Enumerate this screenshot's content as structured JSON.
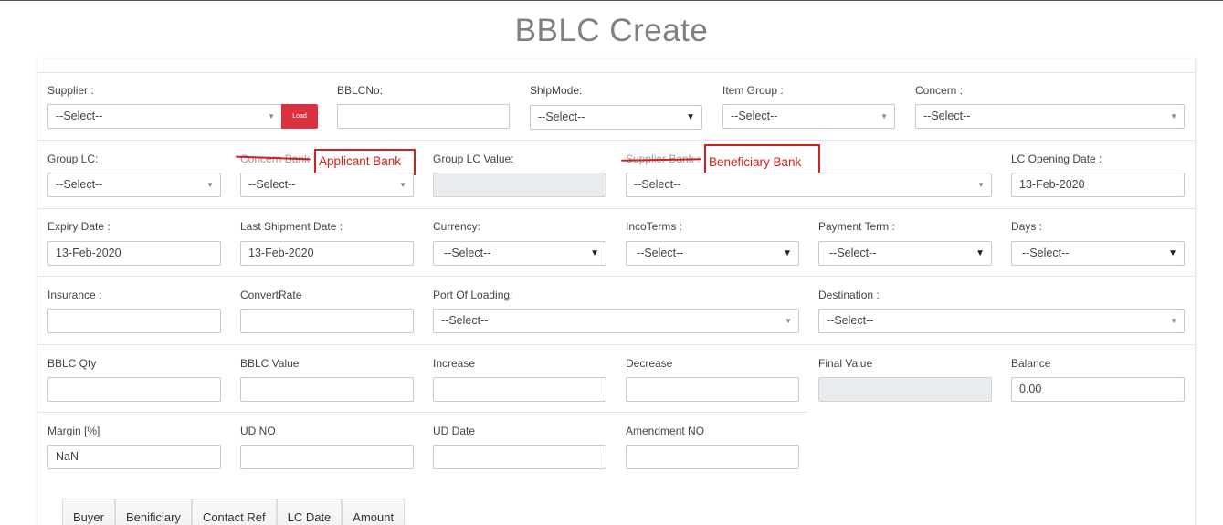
{
  "page": {
    "title": "BBLC Create"
  },
  "rows": {
    "r1": {
      "supplier": {
        "label": "Supplier :",
        "value": "--Select--",
        "load_label": "Load"
      },
      "bblc_no": {
        "label": "BBLCNo:",
        "value": ""
      },
      "ship_mode": {
        "label": "ShipMode:",
        "value": "--Select--"
      },
      "item_group": {
        "label": "Item Group :",
        "value": "--Select--"
      },
      "concern": {
        "label": "Concern :",
        "value": "--Select--"
      }
    },
    "r2": {
      "group_lc": {
        "label": "Group LC:",
        "value": "--Select--"
      },
      "concern_bank": {
        "label": "Concern Bank :",
        "value": "--Select--",
        "annotation": "Applicant Bank"
      },
      "group_lc_value": {
        "label": "Group LC Value:",
        "value": ""
      },
      "supplier_bank": {
        "label": "Supplier Bank :",
        "value": "--Select--",
        "annotation": "Beneficiary Bank"
      },
      "lc_opening_date": {
        "label": "LC Opening Date :",
        "value": "13-Feb-2020"
      }
    },
    "r3": {
      "expiry_date": {
        "label": "Expiry Date :",
        "value": "13-Feb-2020"
      },
      "last_shipment_date": {
        "label": "Last Shipment Date :",
        "value": "13-Feb-2020"
      },
      "currency": {
        "label": "Currency:",
        "value": "--Select--"
      },
      "incoterms": {
        "label": "IncoTerms :",
        "value": "--Select--"
      },
      "payment_term": {
        "label": "Payment Term :",
        "value": "--Select--"
      },
      "days": {
        "label": "Days :",
        "value": "--Select--"
      }
    },
    "r4": {
      "insurance": {
        "label": "Insurance :",
        "value": ""
      },
      "convert_rate": {
        "label": "ConvertRate",
        "value": ""
      },
      "port_of_loading": {
        "label": "Port Of Loading:",
        "value": "--Select--"
      },
      "destination": {
        "label": "Destination :",
        "value": "--Select--"
      }
    },
    "r5": {
      "bblc_qty": {
        "label": "BBLC Qty",
        "value": ""
      },
      "bblc_value": {
        "label": "BBLC Value",
        "value": ""
      },
      "increase": {
        "label": "Increase",
        "value": ""
      },
      "decrease": {
        "label": "Decrease",
        "value": ""
      },
      "final_value": {
        "label": "Final Value",
        "value": ""
      },
      "balance": {
        "label": "Balance",
        "value": "0.00"
      }
    },
    "r6": {
      "margin": {
        "label": "Margin [%]",
        "value": "NaN"
      },
      "ud_no": {
        "label": "UD NO",
        "value": ""
      },
      "ud_date": {
        "label": "UD Date",
        "value": ""
      },
      "amendment_no": {
        "label": "Amendment NO",
        "value": ""
      }
    }
  },
  "table": {
    "headers": [
      "Buyer",
      "Benificiary",
      "Contact Ref",
      "LC Date",
      "Amount"
    ]
  },
  "colors": {
    "annotation_red": "#d0211d",
    "load_button": "#d9333f",
    "readonly_bg": "#e9ecef"
  }
}
